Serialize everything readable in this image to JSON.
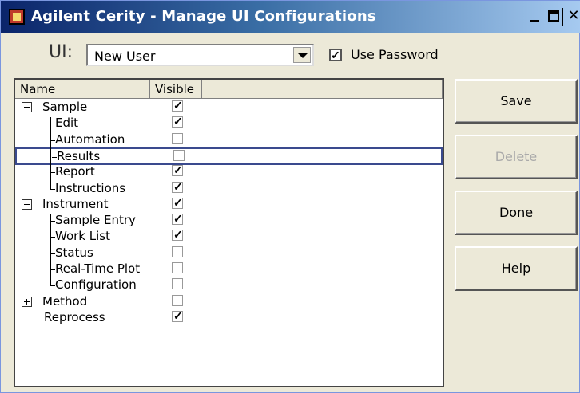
{
  "window": {
    "title": "Agilent Cerity - Manage UI Configurations"
  },
  "ui_selector": {
    "label": "UI:",
    "value": "New User"
  },
  "use_password": {
    "label": "Use Password",
    "checked": true
  },
  "tree": {
    "columns": [
      "Name",
      "Visible"
    ],
    "rows": [
      {
        "label": "Sample",
        "level": 0,
        "expander": "minus",
        "visible": true
      },
      {
        "label": "Edit",
        "level": 1,
        "visible": true
      },
      {
        "label": "Automation",
        "level": 1,
        "visible": false
      },
      {
        "label": "Results",
        "level": 1,
        "visible": false,
        "selected": true
      },
      {
        "label": "Report",
        "level": 1,
        "visible": true
      },
      {
        "label": "Instructions",
        "level": 1,
        "visible": true
      },
      {
        "label": "Instrument",
        "level": 0,
        "expander": "minus",
        "visible": true
      },
      {
        "label": "Sample Entry",
        "level": 1,
        "visible": true
      },
      {
        "label": "Work List",
        "level": 1,
        "visible": true
      },
      {
        "label": "Status",
        "level": 1,
        "visible": false
      },
      {
        "label": "Real-Time Plot",
        "level": 1,
        "visible": false
      },
      {
        "label": "Configuration",
        "level": 1,
        "visible": false
      },
      {
        "label": "Method",
        "level": 0,
        "expander": "plus",
        "visible": false
      },
      {
        "label": "Reprocess",
        "level": 0,
        "visible": true
      }
    ]
  },
  "buttons": {
    "save": "Save",
    "delete": "Delete",
    "done": "Done",
    "help": "Help"
  }
}
